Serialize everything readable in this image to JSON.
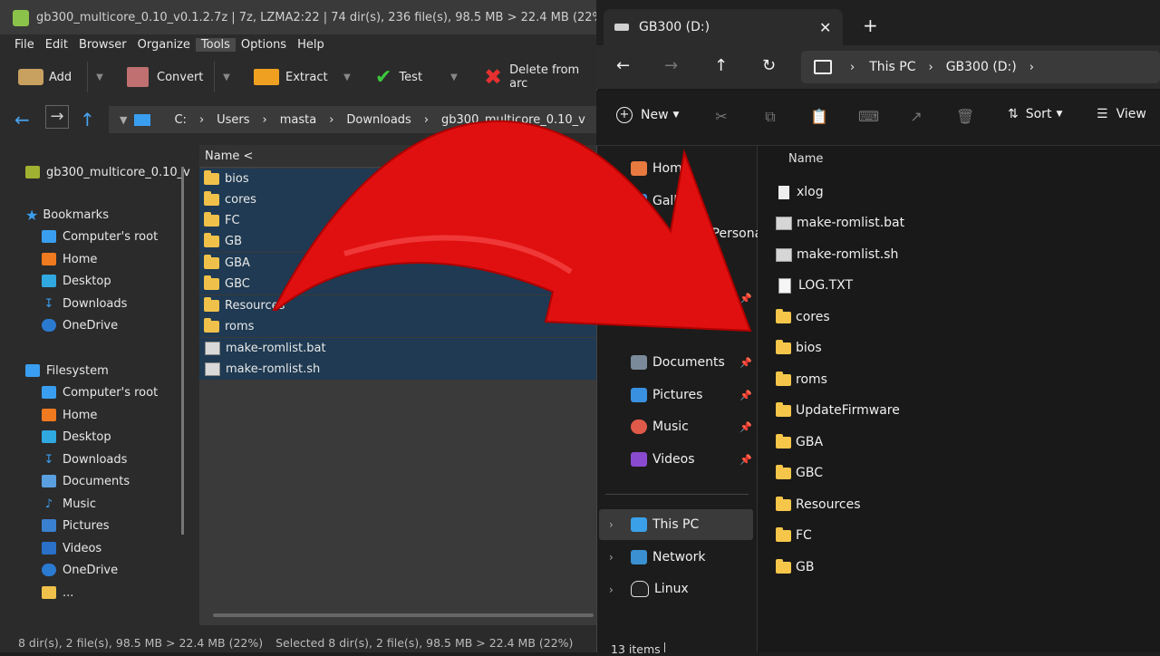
{
  "left_window": {
    "title": "gb300_multicore_0.10_v0.1.2.7z | 7z, LZMA2:22 | 74 dir(s), 236 file(s), 98.5 MB > 22.4 MB (22%)",
    "menu": [
      "File",
      "Edit",
      "Browser",
      "Organize",
      "Tools",
      "Options",
      "Help"
    ],
    "toolbar": {
      "add": "Add",
      "convert": "Convert",
      "extract": "Extract",
      "test": "Test",
      "delete": "Delete from arc"
    },
    "breadcrumb": [
      "C:",
      "Users",
      "masta",
      "Downloads",
      "gb300_multicore_0.10_v"
    ],
    "sidebar": {
      "archive": "gb300_multicore_0.10_v",
      "bookmarks_header": "Bookmarks",
      "bookmarks": [
        "Computer's root",
        "Home",
        "Desktop",
        "Downloads",
        "OneDrive"
      ],
      "filesystem_header": "Filesystem",
      "filesystem": [
        "Computer's root",
        "Home",
        "Desktop",
        "Downloads",
        "Documents",
        "Music",
        "Pictures",
        "Videos",
        "OneDrive",
        "..."
      ]
    },
    "list_header": "Name <",
    "files": [
      {
        "name": "bios",
        "type": "folder"
      },
      {
        "name": "cores",
        "type": "folder"
      },
      {
        "name": "FC",
        "type": "folder"
      },
      {
        "name": "GB",
        "type": "folder"
      },
      {
        "name": "GBA",
        "type": "folder"
      },
      {
        "name": "GBC",
        "type": "folder"
      },
      {
        "name": "Resources",
        "type": "folder"
      },
      {
        "name": "roms",
        "type": "folder"
      },
      {
        "name": "make-romlist.bat",
        "type": "file"
      },
      {
        "name": "make-romlist.sh",
        "type": "file"
      }
    ],
    "status": {
      "total": "8 dir(s), 2 file(s), 98.5 MB > 22.4 MB (22%)",
      "selected": "Selected 8 dir(s), 2 file(s), 98.5 MB > 22.4 MB (22%)"
    }
  },
  "right_window": {
    "tab_title": "GB300 (D:)",
    "address": [
      "This PC",
      "GB300 (D:)"
    ],
    "commands": {
      "new": "New",
      "sort": "Sort",
      "view": "View"
    },
    "nav": {
      "home": "Home",
      "gallery": "Gallery",
      "personal": "Tomasz - Personal",
      "documents": "Documents",
      "pictures": "Pictures",
      "music": "Music",
      "videos": "Videos",
      "thispc": "This PC",
      "network": "Network",
      "linux": "Linux"
    },
    "column_name": "Name",
    "items": [
      {
        "name": "xlog",
        "type": "file"
      },
      {
        "name": "make-romlist.bat",
        "type": "script"
      },
      {
        "name": "make-romlist.sh",
        "type": "script"
      },
      {
        "name": "LOG.TXT",
        "type": "file"
      },
      {
        "name": "cores",
        "type": "folder"
      },
      {
        "name": "bios",
        "type": "folder"
      },
      {
        "name": "roms",
        "type": "folder"
      },
      {
        "name": "UpdateFirmware",
        "type": "folder"
      },
      {
        "name": "GBA",
        "type": "folder"
      },
      {
        "name": "GBC",
        "type": "folder"
      },
      {
        "name": "Resources",
        "type": "folder"
      },
      {
        "name": "FC",
        "type": "folder"
      },
      {
        "name": "GB",
        "type": "folder"
      }
    ],
    "status": "13 items"
  },
  "colors": {
    "accent_red": "#e01010",
    "folder": "#f5c64a",
    "selection": "#1f3a52"
  }
}
